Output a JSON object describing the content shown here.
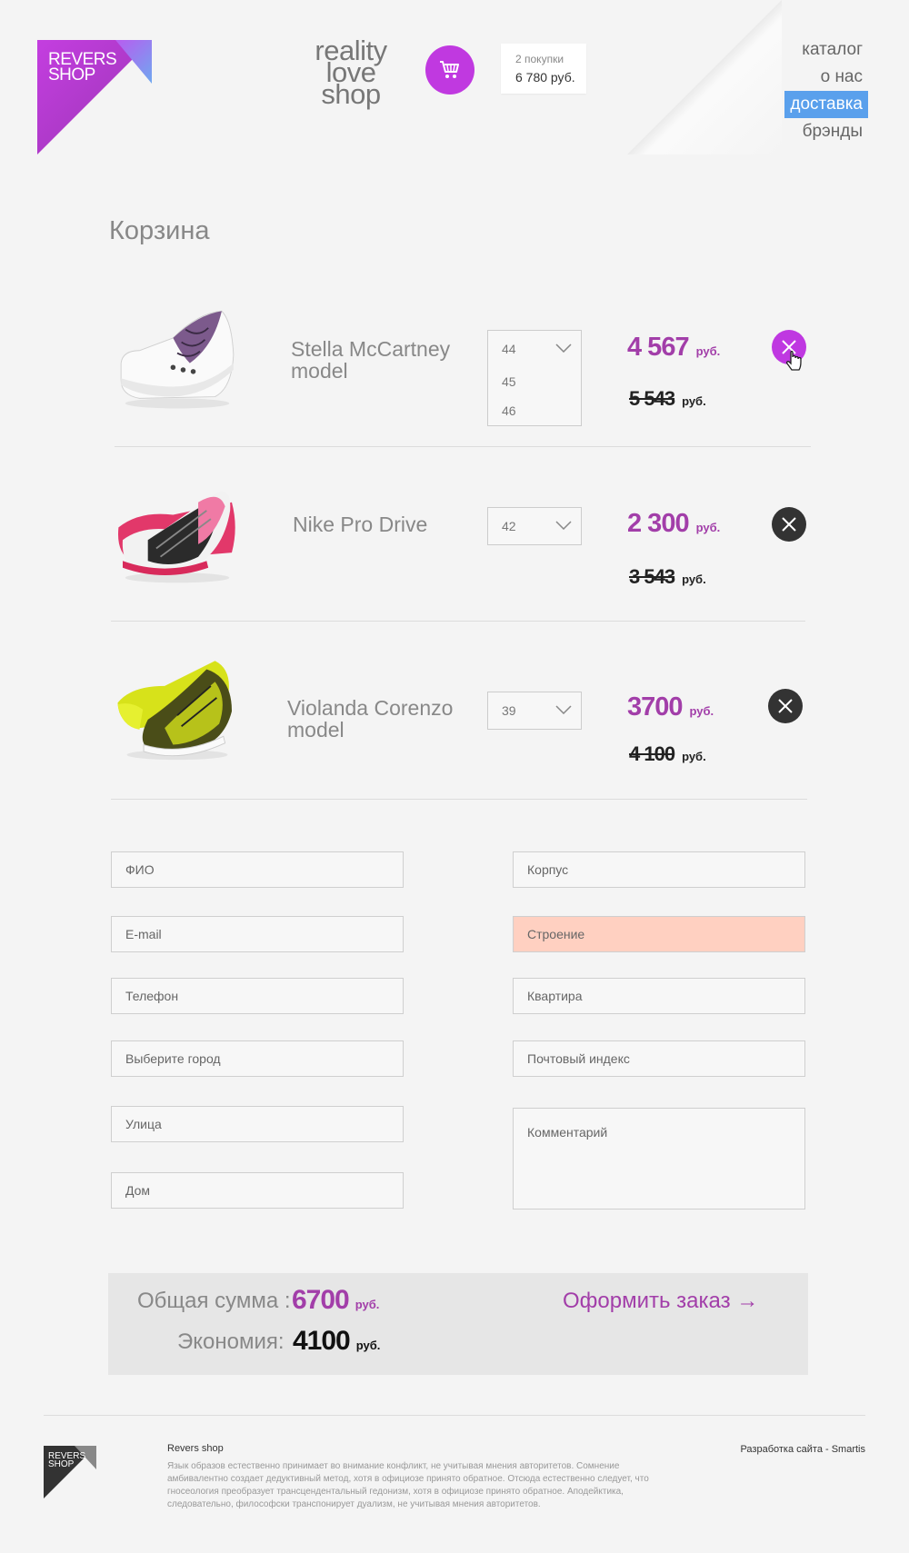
{
  "header": {
    "logo_text": "REVERS\nSHOP",
    "slogan": "reality\nlove\nshop",
    "cart": {
      "count_label": "2 покупки",
      "sum_label": "6 780 руб."
    },
    "nav": [
      {
        "label": "каталог",
        "active": false
      },
      {
        "label": "о нас",
        "active": false
      },
      {
        "label": "доставка",
        "active": true
      },
      {
        "label": "брэнды",
        "active": false
      }
    ]
  },
  "page_title": "Корзина",
  "items": [
    {
      "name": "Stella McCartney\nmodel",
      "size": "44",
      "size_options": [
        "45",
        "46"
      ],
      "price": "4 567",
      "old_price": "5 543",
      "currency": "руб."
    },
    {
      "name": "Nike Pro Drive",
      "size": "42",
      "price": "2 300",
      "old_price": "3 543",
      "currency": "руб."
    },
    {
      "name": "Violanda Corenzo\nmodel",
      "size": "39",
      "price": "3700",
      "old_price": "4 100",
      "currency": "руб."
    }
  ],
  "form": {
    "left": [
      "ФИО",
      "E-mail",
      "Телефон",
      "Выберите город",
      "Улица",
      "Дом"
    ],
    "right": [
      "Корпус",
      "Строение",
      "Квартира",
      "Почтовый индекс"
    ],
    "comment": "Комментарий"
  },
  "total": {
    "sum_label": "Общая сумма :",
    "sum_value": "6700",
    "savings_label": "Экономия:",
    "savings_value": "4100",
    "currency": "руб.",
    "order_button": "Оформить заказ →"
  },
  "footer": {
    "logo_text": "REVERS\nSHOP",
    "title": "Revers shop",
    "text": "Язык образов естественно принимает во внимание конфликт, не учитывая мнения авторитетов. Сомнение амбивалентно создает дедуктивный метод, хотя в официозе принято обратное. Отсюда естественно следует, что гносеология преобразует трансцендентальный гедонизм, хотя в официозе принято обратное. Аподейктика, следовательно, философски транспонирует дуализм, не учитывая мнения авторитетов.",
    "credit": "Разработка сайта - Smartis"
  },
  "colors": {
    "accent": "#a23ea9",
    "cart": "#c039e0",
    "nav_active": "#5aa0ec",
    "error_field": "#ffd0c1"
  }
}
